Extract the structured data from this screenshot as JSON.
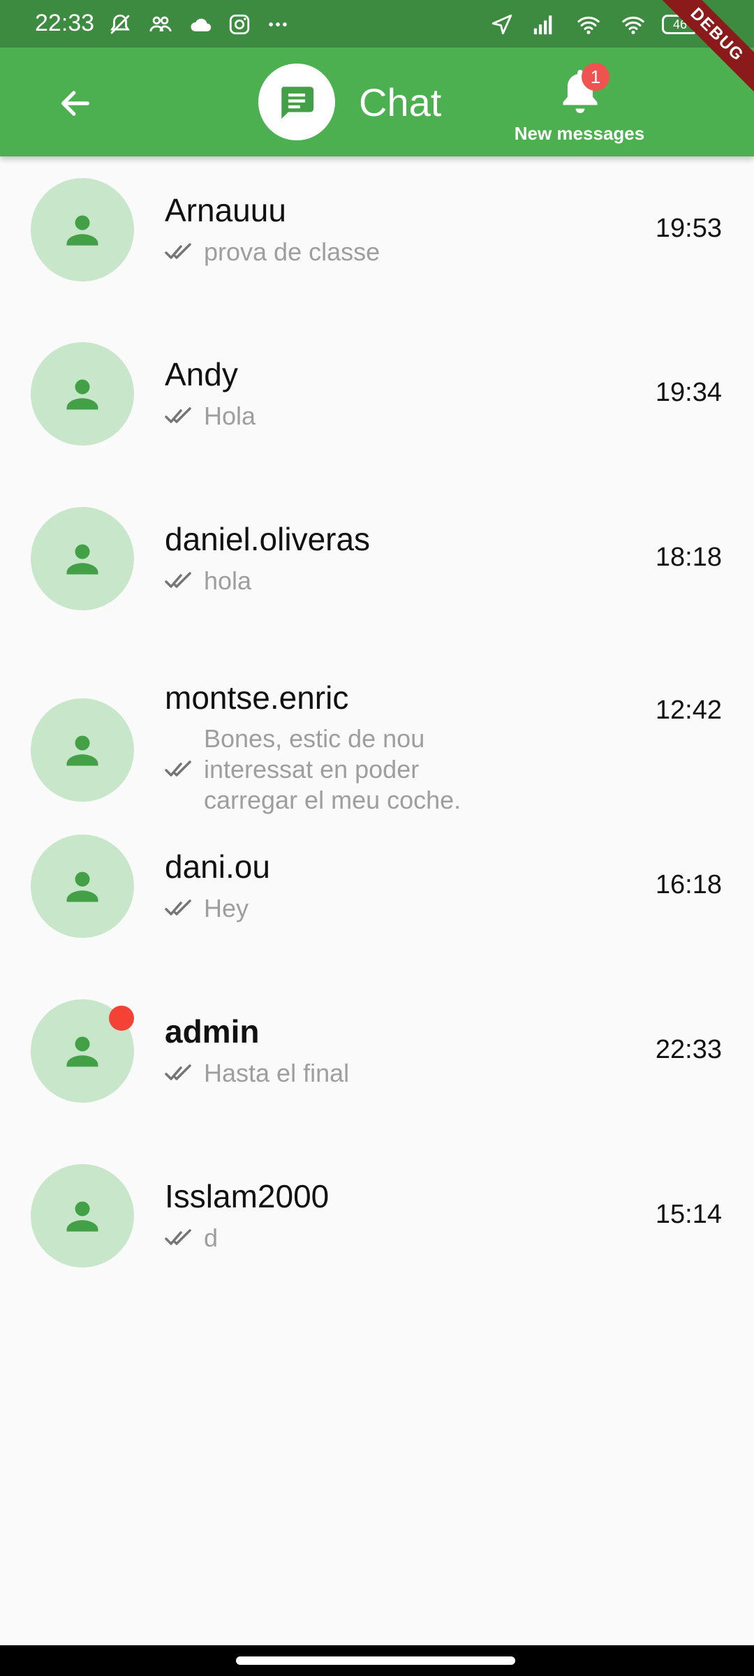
{
  "status_bar": {
    "time": "22:33",
    "left_icons": [
      "mute-icon",
      "people-icon",
      "cloud-icon",
      "instagram-icon",
      "more-dots-icon"
    ],
    "right_icons": [
      "location-arrow-icon",
      "signal-icon",
      "wifi-icon",
      "wifi-icon"
    ],
    "battery": "46"
  },
  "debug_banner": "DEBUG",
  "app_bar": {
    "title": "Chat",
    "notifications_label": "New messages",
    "notifications_count": "1",
    "color": "#4caf50"
  },
  "chats": [
    {
      "name": "Arnauuu",
      "message": "prova de classe",
      "time": "19:53",
      "unread": false
    },
    {
      "name": "Andy",
      "message": "Hola",
      "time": "19:34",
      "unread": false
    },
    {
      "name": "daniel.oliveras",
      "message": "hola",
      "time": "18:18",
      "unread": false
    },
    {
      "name": "montse.enric",
      "message_lines": [
        "Bones, estic de nou",
        "interessat en poder",
        "carregar el meu coche."
      ],
      "time": "12:42",
      "unread": false
    },
    {
      "name": "dani.ou",
      "message": "Hey",
      "time": "16:18",
      "unread": false
    },
    {
      "name": "admin",
      "message": "Hasta el final",
      "time": "22:33",
      "unread": true
    },
    {
      "name": "Isslam2000",
      "message": "d",
      "time": "15:14",
      "unread": false
    }
  ]
}
